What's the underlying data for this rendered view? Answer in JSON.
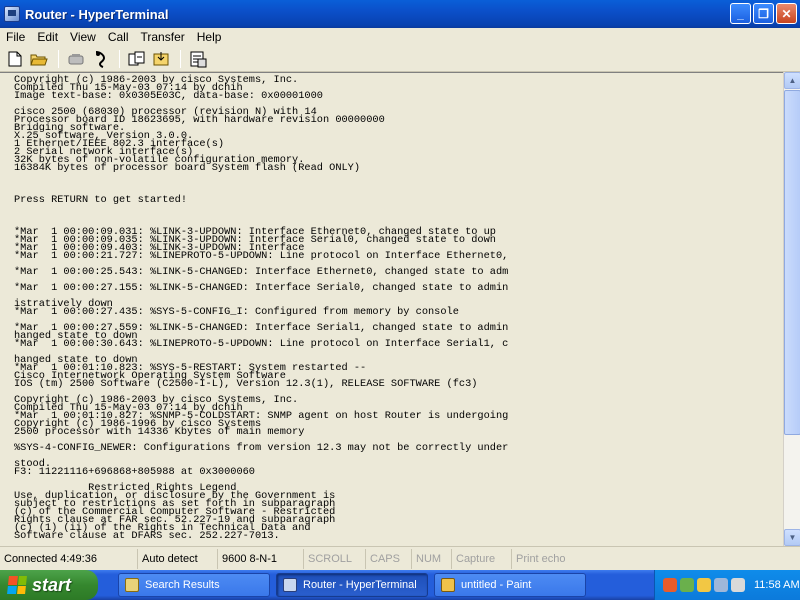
{
  "window": {
    "title": "Router - HyperTerminal",
    "buttons": {
      "minimize": "_",
      "maximize": "❐",
      "close": "✕"
    }
  },
  "menu": [
    "File",
    "Edit",
    "View",
    "Call",
    "Transfer",
    "Help"
  ],
  "toolbar": {
    "icons": [
      "new-connection-icon",
      "open-icon",
      "disconnect-icon",
      "dial-icon",
      "send-icon",
      "receive-icon",
      "properties-icon"
    ]
  },
  "terminal": {
    "text": "Copyright (c) 1986-2003 by cisco Systems, Inc.\nCompiled Thu 15-May-03 07:14 by dchih\nImage text-base: 0x0305E03C, data-base: 0x00001000\n\ncisco 2500 (68030) processor (revision N) with 14\nProcessor board ID 18623695, with hardware revision 00000000\nBridging software.\nX.25 software, Version 3.0.0.\n1 Ethernet/IEEE 802.3 interface(s)\n2 Serial network interface(s)\n32K bytes of non-volatile configuration memory.\n16384K bytes of processor board System flash (Read ONLY)\n\n\n\nPress RETURN to get started!\n\n\n\n*Mar  1 00:00:09.031: %LINK-3-UPDOWN: Interface Ethernet0, changed state to up\n*Mar  1 00:00:09.035: %LINK-3-UPDOWN: Interface Serial0, changed state to down\n*Mar  1 00:00:09.403: %LINK-3-UPDOWN: Interface\n*Mar  1 00:00:21.727: %LINEPROTO-5-UPDOWN: Line protocol on Interface Ethernet0,\n\n*Mar  1 00:00:25.543: %LINK-5-CHANGED: Interface Ethernet0, changed state to adm\n\n*Mar  1 00:00:27.155: %LINK-5-CHANGED: Interface Serial0, changed state to admin\n\nistratively down\n*Mar  1 00:00:27.435: %SYS-5-CONFIG_I: Configured from memory by console\n\n*Mar  1 00:00:27.559: %LINK-5-CHANGED: Interface Serial1, changed state to admin\nhanged state to down\n*Mar  1 00:00:30.643: %LINEPROTO-5-UPDOWN: Line protocol on Interface Serial1, c\n\nhanged state to down\n*Mar  1 00:01:10.823: %SYS-5-RESTART: System restarted --\nCisco Internetwork Operating System Software\nIOS (tm) 2500 Software (C2500-I-L), Version 12.3(1), RELEASE SOFTWARE (fc3)\n\nCopyright (c) 1986-2003 by cisco Systems, Inc.\nCompiled Thu 15-May-03 07:14 by dchih\n*Mar  1 00:01:10.827: %SNMP-5-COLDSTART: SNMP agent on host Router is undergoing\nCopyright (c) 1986-1996 by cisco Systems\n2500 processor with 14336 Kbytes of main memory\n\n%SYS-4-CONFIG_NEWER: Configurations from version 12.3 may not be correctly under\n\nstood.\nF3: 11221116+696868+805988 at 0x3000060\n\n            Restricted Rights Legend\nUse, duplication, or disclosure by the Government is\nsubject to restrictions as set forth in subparagraph\n(c) of the Commercial Computer Software - Restricted\nRights clause at FAR sec. 52.227-19 and subparagraph\n(c) (1) (ii) of the Rights in Technical Data and\nSoftware clause at DFARS sec. 252.227-7013."
  },
  "status": {
    "connected": "Connected 4:49:36",
    "detect": "Auto detect",
    "settings": "9600 8-N-1",
    "scroll": "SCROLL",
    "caps": "CAPS",
    "num": "NUM",
    "capture": "Capture",
    "print_echo": "Print echo"
  },
  "taskbar": {
    "start_label": "start",
    "tasks": [
      {
        "label": "Search Results"
      },
      {
        "label": "Router - HyperTerminal"
      },
      {
        "label": "untitled - Paint"
      }
    ],
    "clock": "11:58 AM"
  }
}
